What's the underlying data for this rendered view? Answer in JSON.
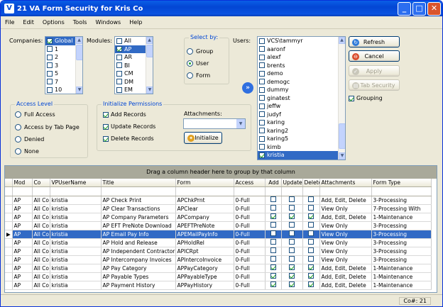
{
  "window": {
    "title": "21 VA Form Security for Kris Co",
    "app_icon": "V"
  },
  "menu": [
    "File",
    "Edit",
    "Options",
    "Tools",
    "Windows",
    "Help"
  ],
  "companies": {
    "label": "Companies:",
    "items": [
      {
        "label": "Global",
        "checked": true,
        "selected": true
      },
      {
        "label": "1",
        "checked": false
      },
      {
        "label": "2",
        "checked": false
      },
      {
        "label": "3",
        "checked": false
      },
      {
        "label": "5",
        "checked": false
      },
      {
        "label": "7",
        "checked": false
      },
      {
        "label": "10",
        "checked": false
      }
    ]
  },
  "modules": {
    "label": "Modules:",
    "items": [
      {
        "label": "All",
        "checked": false
      },
      {
        "label": "AP",
        "checked": true,
        "selected": true
      },
      {
        "label": "AR",
        "checked": false
      },
      {
        "label": "BI",
        "checked": false
      },
      {
        "label": "CM",
        "checked": false
      },
      {
        "label": "DM",
        "checked": false
      },
      {
        "label": "EM",
        "checked": false
      }
    ]
  },
  "select_by": {
    "label": "Select by:",
    "options": [
      "Group",
      "User",
      "Form"
    ],
    "selected": "User"
  },
  "users": {
    "label": "Users:",
    "items": [
      {
        "label": "VCS\\tammyr",
        "checked": false
      },
      {
        "label": "aaronf",
        "checked": false
      },
      {
        "label": "alexf",
        "checked": false
      },
      {
        "label": "brents",
        "checked": false
      },
      {
        "label": "demo",
        "checked": false
      },
      {
        "label": "demogc",
        "checked": false
      },
      {
        "label": "dummy",
        "checked": false
      },
      {
        "label": "ginatest",
        "checked": false
      },
      {
        "label": "jeffw",
        "checked": false
      },
      {
        "label": "judyf",
        "checked": false
      },
      {
        "label": "karing",
        "checked": false
      },
      {
        "label": "karing2",
        "checked": false
      },
      {
        "label": "karing5",
        "checked": false
      },
      {
        "label": "kimb",
        "checked": false
      },
      {
        "label": "kristia",
        "checked": true,
        "selected": true
      }
    ]
  },
  "buttons": {
    "refresh": "Refresh",
    "cancel": "Cancel",
    "apply": "Apply",
    "tab_security": "Tab Security",
    "initialize": "Initialize"
  },
  "grouping": {
    "label": "Grouping",
    "checked": true
  },
  "access_level": {
    "label": "Access Level",
    "options": [
      "Full Access",
      "Access by Tab Page",
      "Denied",
      "None"
    ]
  },
  "init_perms": {
    "label": "Initialize Permissions",
    "options": [
      {
        "label": "Add Records",
        "checked": true
      },
      {
        "label": "Update Records",
        "checked": true
      },
      {
        "label": "Delete Records",
        "checked": true
      }
    ],
    "attachments_label": "Attachments:",
    "attachments_value": ""
  },
  "grid": {
    "group_hint": "Drag a column header here to group by that column",
    "columns": [
      "Mod",
      "Co",
      "VPUserName",
      "Title",
      "Form",
      "Access",
      "Add",
      "Update",
      "Delete",
      "Attachments",
      "Form Type"
    ],
    "rows": [
      {
        "mod": "AP",
        "co": "All Co",
        "user": "kristia",
        "title": "AP Check Print",
        "form": "APChkPrnt",
        "access": "0-Full",
        "add": false,
        "update": false,
        "delete": false,
        "att": "Add, Edit, Delete",
        "type": "3-Processing"
      },
      {
        "mod": "AP",
        "co": "All Co",
        "user": "kristia",
        "title": "AP Clear Transactions",
        "form": "APClear",
        "access": "0-Full",
        "add": false,
        "update": false,
        "delete": false,
        "att": "View Only",
        "type": "7-Processing With"
      },
      {
        "mod": "AP",
        "co": "All Co",
        "user": "kristia",
        "title": "AP Company Parameters",
        "form": "APCompany",
        "access": "0-Full",
        "add": true,
        "update": true,
        "delete": true,
        "att": "Add, Edit, Delete",
        "type": "1-Maintenance"
      },
      {
        "mod": "AP",
        "co": "All Co",
        "user": "kristia",
        "title": "AP EFT PreNote Download",
        "form": "APEFTPreNote",
        "access": "0-Full",
        "add": false,
        "update": false,
        "delete": false,
        "att": "View Only",
        "type": "3-Processing"
      },
      {
        "mod": "AP",
        "co": "All Co",
        "user": "kristia",
        "title": "AP Email Pay Info",
        "form": "APEMailPayInfo",
        "access": "0-Full",
        "add": false,
        "update": false,
        "delete": false,
        "att": "View Only",
        "type": "3-Processing",
        "current": true
      },
      {
        "mod": "AP",
        "co": "All Co",
        "user": "kristia",
        "title": "AP Hold and Release",
        "form": "APHoldRel",
        "access": "0-Full",
        "add": false,
        "update": false,
        "delete": false,
        "att": "View Only",
        "type": "3-Processing"
      },
      {
        "mod": "AP",
        "co": "All Co",
        "user": "kristia",
        "title": "AP Independent Contractor",
        "form": "APICRpt",
        "access": "0-Full",
        "add": false,
        "update": false,
        "delete": false,
        "att": "View Only",
        "type": "3-Processing"
      },
      {
        "mod": "AP",
        "co": "All Co",
        "user": "kristia",
        "title": "AP Intercompany Invoices",
        "form": "APIntercoInvoice",
        "access": "0-Full",
        "add": false,
        "update": false,
        "delete": false,
        "att": "View Only",
        "type": "3-Processing"
      },
      {
        "mod": "AP",
        "co": "All Co",
        "user": "kristia",
        "title": "AP Pay Category",
        "form": "APPayCategory",
        "access": "0-Full",
        "add": true,
        "update": true,
        "delete": true,
        "att": "Add, Edit, Delete",
        "type": "1-Maintenance"
      },
      {
        "mod": "AP",
        "co": "All Co",
        "user": "kristia",
        "title": "AP Payable Types",
        "form": "APPayableType",
        "access": "0-Full",
        "add": true,
        "update": true,
        "delete": true,
        "att": "Add, Edit, Delete",
        "type": "1-Maintenance"
      },
      {
        "mod": "AP",
        "co": "All Co",
        "user": "kristia",
        "title": "AP Payment History",
        "form": "APPayHistory",
        "access": "0-Full",
        "add": true,
        "update": true,
        "delete": true,
        "att": "Add, Edit, Delete",
        "type": "1-Maintenance"
      }
    ]
  },
  "status": {
    "co": "Co#: 21"
  },
  "colors": {
    "title_bar": "#0a5ee6",
    "selection": "#316ac5",
    "group_label": "#0046d5",
    "check": "#21a121"
  }
}
